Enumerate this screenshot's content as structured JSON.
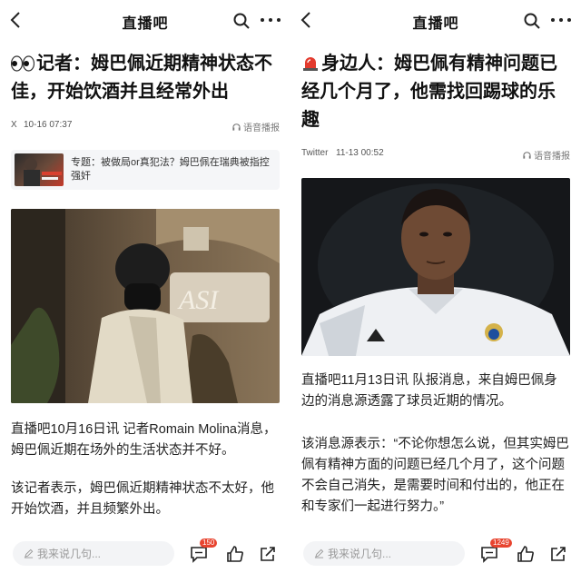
{
  "left": {
    "header": {
      "logo": "直播吧"
    },
    "title": "记者：姆巴佩近期精神状态不佳，开始饮酒并且经常外出",
    "meta": {
      "source": "X",
      "time": "10-16 07:37",
      "tts": "语音播报"
    },
    "topic": {
      "text": "专题：被做局or真犯法？姆巴佩在瑞典被指控强奸"
    },
    "paragraphs": [
      "直播吧10月16日讯 记者Romain Molina消息，姆巴佩近期在场外的生活状态并不好。",
      "该记者表示，姆巴佩近期精神状态不太好，他开始饮酒，并且频繁外出。"
    ],
    "bottom": {
      "placeholder": "我来说几句...",
      "comment_count": "150"
    }
  },
  "right": {
    "header": {
      "logo": "直播吧"
    },
    "title": "身边人：姆巴佩有精神问题已经几个月了，他需找回踢球的乐趣",
    "meta": {
      "source": "Twitter",
      "time": "11-13 00:52",
      "tts": "语音播报"
    },
    "paragraphs": [
      "直播吧11月13日讯 队报消息，来自姆巴佩身边的消息源透露了球员近期的情况。",
      "该消息源表示：“不论你想怎么说，但其实姆巴佩有精神方面的问题已经几个月了，这个问题不会自己消失，是需要时间和付出的，他正在和专家们一起进行努力。”"
    ],
    "bottom": {
      "placeholder": "我来说几句...",
      "comment_count": "1249"
    }
  },
  "colors": {
    "badge": "#e8442f",
    "input_bg": "#f3f4f6",
    "text": "#222222",
    "meta": "#555555"
  },
  "icons": [
    "back-icon",
    "search-icon",
    "more-icon",
    "eyes-emoji-icon",
    "siren-emoji-icon",
    "speaker-icon",
    "pencil-icon",
    "comment-icon",
    "thumbs-up-icon",
    "share-icon"
  ]
}
